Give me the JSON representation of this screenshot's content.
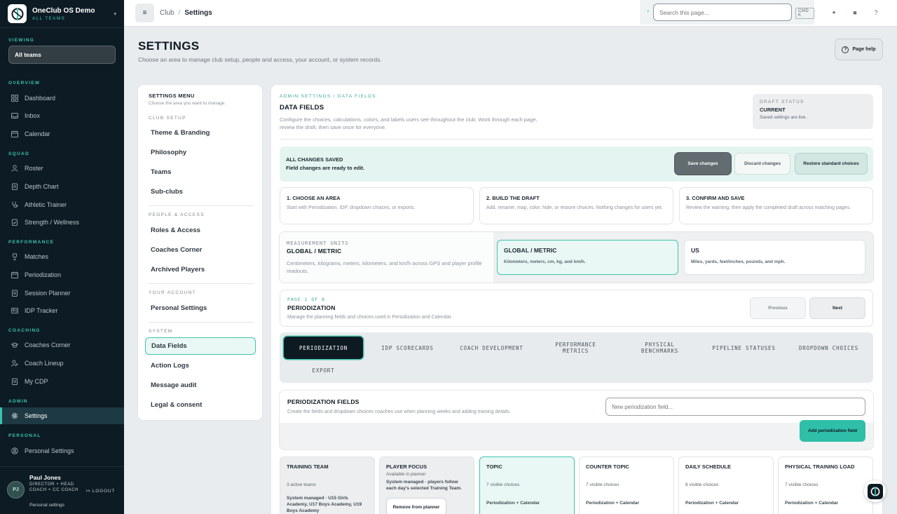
{
  "brand": {
    "name": "OneClub OS Demo",
    "sub": "ALL TEAMS"
  },
  "sidebar": {
    "viewing_label": "VIEWING",
    "viewing_value": "All teams",
    "sections": [
      {
        "label": "OVERVIEW",
        "items": [
          "Dashboard",
          "Inbox",
          "Calendar"
        ]
      },
      {
        "label": "SQUAD",
        "items": [
          "Roster",
          "Depth Chart",
          "Athletic Trainer",
          "Strength / Wellness"
        ]
      },
      {
        "label": "PERFORMANCE",
        "items": [
          "Matches",
          "Periodization",
          "Session Planner",
          "IDP Tracker"
        ]
      },
      {
        "label": "COACHING",
        "items": [
          "Coaches Corner",
          "Coach Lineup",
          "My CDP"
        ]
      },
      {
        "label": "ADMIN",
        "items": [
          "Settings"
        ]
      },
      {
        "label": "PERSONAL",
        "items": [
          "Personal Settings"
        ]
      }
    ],
    "active_item": "Settings",
    "user": {
      "initials": "PJ",
      "name": "Paul Jones",
      "role": "DIRECTOR + HEAD COACH + CC COACH",
      "logout": "LOGOUT",
      "settings_link": "Personal settings"
    }
  },
  "topbar": {
    "crumb_root": "Club",
    "crumb_sep": "/",
    "crumb_current": "Settings",
    "search_placeholder": "Search this page...",
    "shortcut": "CMD K"
  },
  "page": {
    "title": "SETTINGS",
    "subtitle": "Choose an area to manage club setup, people and access, your account, or system records.",
    "help": "Page help"
  },
  "settings_menu": {
    "title": "SETTINGS MENU",
    "subtitle": "Choose the area you want to manage.",
    "groups": [
      {
        "label": "CLUB SETUP",
        "items": [
          "Theme & Branding",
          "Philosophy",
          "Teams",
          "Sub-clubs"
        ]
      },
      {
        "label": "PEOPLE & ACCESS",
        "items": [
          "Roles & Access",
          "Coaches Corner",
          "Archived Players"
        ]
      },
      {
        "label": "YOUR ACCOUNT",
        "items": [
          "Personal Settings"
        ]
      },
      {
        "label": "SYSTEM",
        "items": [
          "Data Fields",
          "Action Logs",
          "Message audit",
          "Legal & consent"
        ]
      }
    ],
    "active": "Data Fields"
  },
  "main": {
    "eyebrow": "ADMIN SETTINGS / DATA FIELDS",
    "title": "DATA FIELDS",
    "description": "Configure the choices, calculations, colors, and labels users see throughout the club. Work through each page, review the draft, then save once for everyone.",
    "draft": {
      "label": "DRAFT STATUS",
      "value": "CURRENT",
      "note": "Saved settings are live."
    },
    "banner": {
      "title": "ALL CHANGES SAVED",
      "subtitle": "Field changes are ready to edit.",
      "save": "Save changes",
      "discard": "Discard changes",
      "restore": "Restore standard choices"
    },
    "steps": [
      {
        "title": "1. CHOOSE AN AREA",
        "desc": "Start with Periodization, IDP, dropdown choices, or exports."
      },
      {
        "title": "2. BUILD THE DRAFT",
        "desc": "Add, rename, map, color, hide, or restore choices. Nothing changes for users yet."
      },
      {
        "title": "3. CONFIRM AND SAVE",
        "desc": "Review the warning, then apply the completed draft across matching pages."
      }
    ],
    "units": {
      "label": "MEASUREMENT UNITS",
      "current": "GLOBAL / METRIC",
      "desc": "Centimeters, kilograms, meters, kilometers, and km/h across GPS and player profile readouts.",
      "options": [
        {
          "title": "GLOBAL / METRIC",
          "desc": "Kilometers, meters, cm, kg, and km/h."
        },
        {
          "title": "US",
          "desc": "Miles, yards, feet/inches, pounds, and mph."
        }
      ]
    },
    "pager": {
      "eyebrow": "PAGE 1 OF 8",
      "title": "PERIODIZATION",
      "desc": "Manage the planning fields and choices used in Periodization and Calendar.",
      "prev": "Previous",
      "next": "Next"
    },
    "tabs": [
      "PERIODIZATION",
      "IDP SCORECARDS",
      "COACH DEVELOPMENT",
      "PERFORMANCE METRICS",
      "PHYSICAL BENCHMARKS",
      "PIPELINE STATUSES",
      "DROPDOWN CHOICES",
      "EXPORT"
    ],
    "fields": {
      "title": "PERIODIZATION FIELDS",
      "desc": "Create the fields and dropdown choices coaches use when planning weeks and adding training details.",
      "placeholder": "New periodization field...",
      "add": "Add periodization field"
    },
    "field_cards": [
      {
        "title": "TRAINING TEAM",
        "count": "3 active teams",
        "meta": "System managed · U15 Girls Academy, U17 Boys Academy, U19 Boys Academy"
      },
      {
        "title": "PLAYER FOCUS",
        "count": "Available in planner",
        "meta": "System managed · players follow each day's selected Training Team.",
        "action": "Remove from planner"
      },
      {
        "title": "TOPIC",
        "count": "7 visible choices",
        "meta": "Periodization + Calendar"
      },
      {
        "title": "COUNTER TOPIC",
        "count": "7 visible choices",
        "meta": "Periodization + Calendar"
      },
      {
        "title": "DAILY SCHEDULE",
        "count": "8 visible choices",
        "meta": "Periodization + Calendar"
      },
      {
        "title": "PHYSICAL TRAINING LOAD",
        "count": "7 visible choices",
        "meta": "Periodization + Calendar"
      }
    ]
  },
  "colors": {
    "accent": "#39c3ae",
    "sidebar": "#0d1b24",
    "dark": "#0e1a22"
  }
}
